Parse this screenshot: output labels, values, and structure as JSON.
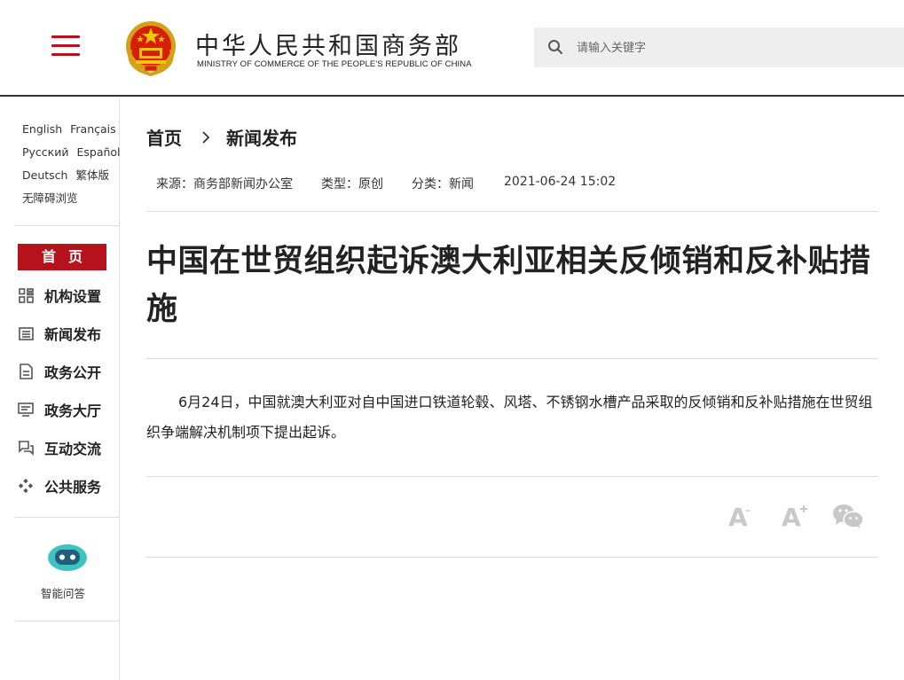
{
  "header": {
    "title": "中华人民共和国商务部",
    "subtitle": "MINISTRY OF COMMERCE OF THE PEOPLE'S REPUBLIC OF CHINA",
    "search_placeholder": "请输入关键字"
  },
  "sidebar": {
    "languages": [
      [
        "English",
        "Français"
      ],
      [
        "Русский",
        "Español"
      ],
      [
        "Deutsch",
        "繁体版"
      ],
      [
        "无障碍浏览"
      ]
    ],
    "home_label": "首页",
    "nav": [
      {
        "label": "机构设置",
        "icon": "grid-icon"
      },
      {
        "label": "新闻发布",
        "icon": "news-icon"
      },
      {
        "label": "政务公开",
        "icon": "document-icon"
      },
      {
        "label": "政务大厅",
        "icon": "monitor-icon"
      },
      {
        "label": "互动交流",
        "icon": "chat-icon"
      },
      {
        "label": "公共服务",
        "icon": "service-icon"
      }
    ],
    "assistant_label": "智能问答"
  },
  "breadcrumb": {
    "home": "首页",
    "current": "新闻发布"
  },
  "meta": {
    "source": "来源：商务部新闻办公室",
    "type": "类型：原创",
    "category": "分类：新闻",
    "date": "2021-06-24 15:02"
  },
  "article": {
    "title": "中国在世贸组织起诉澳大利亚相关反倾销和反补贴措施",
    "body": "6月24日，中国就澳大利亚对自中国进口铁道轮毂、风塔、不锈钢水槽产品采取的反倾销和反补贴措施在世贸组织争端解决机制项下提出起诉。"
  },
  "colors": {
    "brand_red": "#b5121b",
    "icon_gray": "#c8c8c8"
  }
}
